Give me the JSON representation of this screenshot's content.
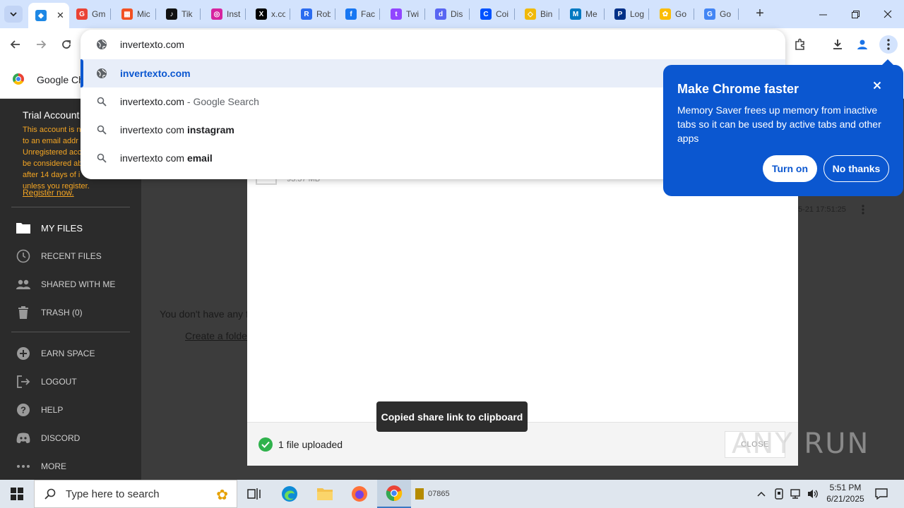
{
  "browser": {
    "tabs": [
      {
        "label": "",
        "fav_color": "#1e88e5",
        "fav_glyph": "◆",
        "active": true
      },
      {
        "label": "Gm",
        "fav_color": "#ea4335",
        "fav_glyph": "G",
        "active": false
      },
      {
        "label": "Mic",
        "fav_color": "#f25022",
        "fav_glyph": "▦",
        "active": false
      },
      {
        "label": "Tik",
        "fav_color": "#111111",
        "fav_glyph": "♪",
        "active": false
      },
      {
        "label": "Inst",
        "fav_color": "#d6249f",
        "fav_glyph": "◎",
        "active": false
      },
      {
        "label": "x.co",
        "fav_color": "#000000",
        "fav_glyph": "X",
        "active": false
      },
      {
        "label": "Rob",
        "fav_color": "#2b6cf0",
        "fav_glyph": "R",
        "active": false
      },
      {
        "label": "Fac",
        "fav_color": "#1877f2",
        "fav_glyph": "f",
        "active": false
      },
      {
        "label": "Twi",
        "fav_color": "#9146ff",
        "fav_glyph": "t",
        "active": false
      },
      {
        "label": "Dis",
        "fav_color": "#5865f2",
        "fav_glyph": "d",
        "active": false
      },
      {
        "label": "Coi",
        "fav_color": "#0052ff",
        "fav_glyph": "C",
        "active": false
      },
      {
        "label": "Bin",
        "fav_color": "#f0b90b",
        "fav_glyph": "◇",
        "active": false
      },
      {
        "label": "Me",
        "fav_color": "#0079c1",
        "fav_glyph": "M",
        "active": false
      },
      {
        "label": "Log",
        "fav_color": "#003087",
        "fav_glyph": "P",
        "active": false
      },
      {
        "label": "Go",
        "fav_color": "#fbbc04",
        "fav_glyph": "✿",
        "active": false
      },
      {
        "label": "Go",
        "fav_color": "#4285f4",
        "fav_glyph": "G",
        "active": false
      }
    ]
  },
  "omnibox": {
    "input_value": "invertexto.com",
    "suggestions": [
      {
        "icon": "globe-icon",
        "main": "invertexto.com",
        "bold": "",
        "suffix": "",
        "type": "url"
      },
      {
        "icon": "search-icon",
        "main": "invertexto.com",
        "bold": "",
        "suffix": " - Google Search",
        "type": "search"
      },
      {
        "icon": "search-icon",
        "main": "invertexto com ",
        "bold": "instagram",
        "suffix": "",
        "type": "search"
      },
      {
        "icon": "search-icon",
        "main": "invertexto com ",
        "bold": "email",
        "suffix": "",
        "type": "search"
      }
    ]
  },
  "pagebar": {
    "site_label": "Google Ch"
  },
  "sidebar": {
    "trial_title": "Trial Account",
    "trial_lines": [
      "This account is no",
      "to an email addr",
      "Unregistered acc",
      "be considered ab",
      "after 14 days of i",
      "unless you register."
    ],
    "register_link": "Register now.",
    "items": [
      {
        "label": "MY FILES",
        "icon": "folder-icon"
      },
      {
        "label": "RECENT FILES",
        "icon": "clock-icon"
      },
      {
        "label": "SHARED WITH ME",
        "icon": "people-icon"
      },
      {
        "label": "TRASH (0)",
        "icon": "trash-icon"
      },
      {
        "label": "EARN SPACE",
        "icon": "plus-circle-icon"
      },
      {
        "label": "LOGOUT",
        "icon": "logout-icon"
      },
      {
        "label": "HELP",
        "icon": "help-icon"
      },
      {
        "label": "DISCORD",
        "icon": "discord-icon"
      },
      {
        "label": "MORE",
        "icon": "more-icon"
      }
    ]
  },
  "main": {
    "empty_message": "You don't have any f",
    "create_folder": "Create a folde",
    "bg_date": "5-21 17:51:25"
  },
  "modal": {
    "file_size": "93.37 MB",
    "uploaded_text": "1 file uploaded",
    "close_label": "CLOSE"
  },
  "toast": {
    "text": "Copied share link to clipboard"
  },
  "promo": {
    "title": "Make Chrome faster",
    "body": "Memory Saver frees up memory from inactive tabs so it can be used by active tabs and other apps",
    "turn_on": "Turn on",
    "no_thanks": "No thanks"
  },
  "watermark": "ANY RUN",
  "taskbar": {
    "search_placeholder": "Type here to search",
    "time": "5:51 PM",
    "date": "6/21/2025",
    "minimized_app_label": "07865"
  },
  "colors": {
    "accent": "#0b57d0",
    "warning": "#f5a623",
    "success": "#2fb24c"
  }
}
